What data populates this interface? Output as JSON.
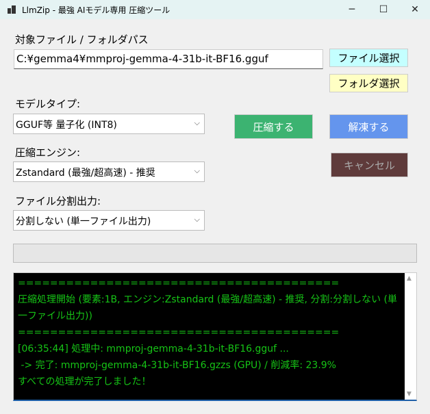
{
  "window": {
    "title": "LlmZip - 最強 AIモデル専用 圧縮ツール",
    "minimize": "─",
    "maximize": "☐",
    "close": "✕"
  },
  "path": {
    "label": "対象ファイル / フォルダパス",
    "value": "C:¥gemma4¥mmproj-gemma-4-31b-it-BF16.gguf",
    "file_button": "ファイル選択",
    "folder_button": "フォルダ選択"
  },
  "model_type": {
    "label": "モデルタイプ:",
    "selected": "GGUF等 量子化 (INT8)"
  },
  "engine": {
    "label": "圧縮エンジン:",
    "selected": "Zstandard (最強/超高速) - 推奨"
  },
  "split": {
    "label": "ファイル分割出力:",
    "selected": "分割しない (単一ファイル出力)"
  },
  "actions": {
    "compress": "圧縮する",
    "decompress": "解凍する",
    "cancel": "キャンセル"
  },
  "progress": {
    "value_percent": 0
  },
  "log": {
    "lines": [
      "========================================",
      "圧縮処理開始 (要素:1B, エンジン:Zstandard (最強/超高速) - 推奨, 分割:分割しない (単一ファイル出力))",
      "========================================",
      "[06:35:44] 処理中: mmproj-gemma-4-31b-it-BF16.gguf ...",
      " -> 完了: mmproj-gemma-4-31b-it-BF16.gzzs (GPU) / 削減率: 23.9%",
      "すべての処理が完了しました！"
    ]
  },
  "colors": {
    "compress": "#3cb371",
    "decompress": "#6495ed",
    "cancel": "#5f3b3b",
    "file_btn": "#c4ffff",
    "folder_btn": "#ffffc4",
    "log_text": "#16c416"
  }
}
